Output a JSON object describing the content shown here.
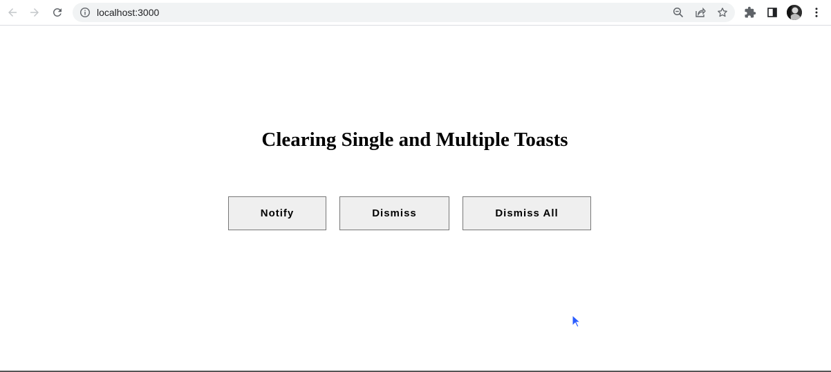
{
  "browser": {
    "url": "localhost:3000",
    "icons": {
      "back": "arrow-left-icon",
      "forward": "arrow-right-icon",
      "reload": "reload-icon",
      "site_info": "info-icon",
      "zoom": "zoom-out-icon",
      "share": "share-icon",
      "bookmark": "star-icon",
      "extensions": "puzzle-icon",
      "side_panel": "side-panel-icon",
      "profile": "avatar",
      "menu": "kebab-menu-icon"
    }
  },
  "main": {
    "title": "Clearing Single and Multiple Toasts",
    "buttons": {
      "notify": "Notify",
      "dismiss": "Dismiss",
      "dismiss_all": "Dismiss All"
    }
  },
  "colors": {
    "button_bg": "#efefef",
    "button_border": "#767676",
    "omnibox_bg": "#f1f3f4",
    "cursor": "#2a5cff"
  }
}
